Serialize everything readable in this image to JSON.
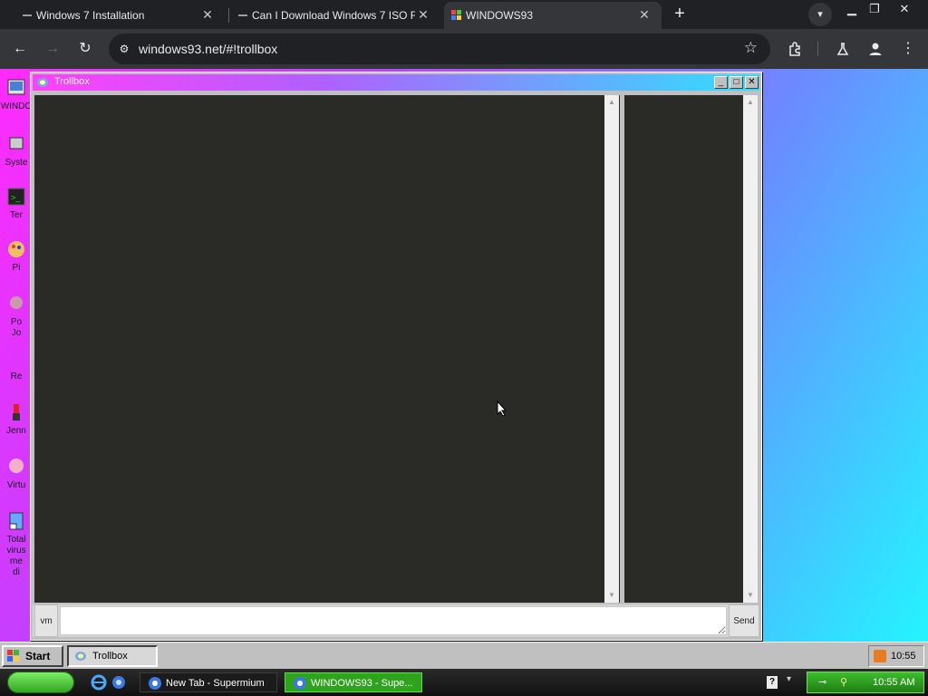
{
  "browser": {
    "tabs": [
      {
        "title": "Windows 7 Installation",
        "active": false,
        "favicon": "page-icon"
      },
      {
        "title": "Can I Download Windows 7 ISO Fi",
        "active": false,
        "favicon": "page-icon"
      },
      {
        "title": "WINDOWS93",
        "active": true,
        "favicon": "windows93-icon"
      }
    ],
    "address_url": "windows93.net/#!trollbox"
  },
  "desktop": {
    "icons": [
      {
        "label": "WINDO",
        "icon": "windows93-icon"
      },
      {
        "label": "Syste",
        "icon": "system-icon"
      },
      {
        "label": "Ter",
        "icon": "terminal-icon"
      },
      {
        "label": "Pi",
        "icon": "paint-icon"
      },
      {
        "label": "Po\nJo",
        "icon": "poney-icon"
      },
      {
        "label": "Re",
        "icon": "recycle-icon"
      },
      {
        "label": "Jenn",
        "icon": "lipstick-icon"
      },
      {
        "label": "Virtu",
        "icon": "virtual-girl-icon"
      },
      {
        "label": "Total\nvirus\nme\ndi",
        "icon": "shortcut-icon"
      }
    ]
  },
  "trollbox": {
    "title": "Trollbox",
    "nick_button": "vm",
    "send_button": "Send",
    "message_value": "",
    "messages": [],
    "users": []
  },
  "w93_taskbar": {
    "start_label": "Start",
    "task_label": "Trollbox",
    "clock": "10:55"
  },
  "os_taskbar": {
    "tasks": [
      {
        "label": "New Tab - Supermium",
        "active": false
      },
      {
        "label": "WINDOWS93 - Supe...",
        "active": true
      }
    ],
    "clock": "10:55 AM"
  }
}
